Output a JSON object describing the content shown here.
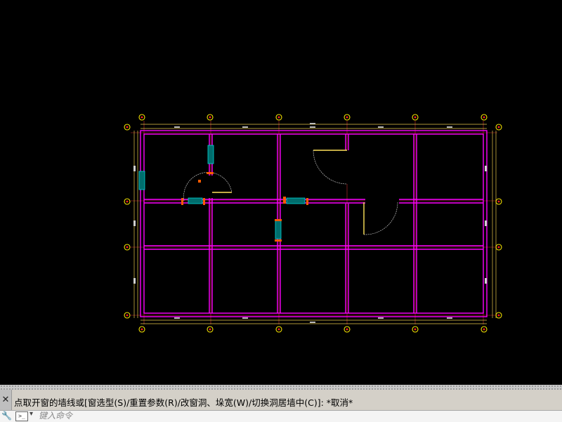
{
  "command_line": {
    "history_text": "点取开窗的墙线或[窗选型(S)/重置参数(R)/改窗洞、垛宽(W)/切换洞居墙中(C)]: *取消*",
    "input_placeholder": "键入命令",
    "close_glyph": "✕",
    "tool_glyph": "🔧",
    "prompt_glyph": ">_",
    "dropdown_glyph": "▾"
  },
  "drawing": {
    "kind": "floor-plan",
    "background": "#000000",
    "colors": {
      "wall": "#ff00ff",
      "grid_axis": "#ff3b3b",
      "dimension": "#ffe35a",
      "axis_bubble": "#f5e200",
      "axis_bubble_center": "#ff2020",
      "window": "#00d6d6",
      "door": "#ffe35a",
      "column": "#ff5a00"
    },
    "icons": [
      "axis-bubble",
      "window-symbol",
      "door-swing"
    ]
  }
}
